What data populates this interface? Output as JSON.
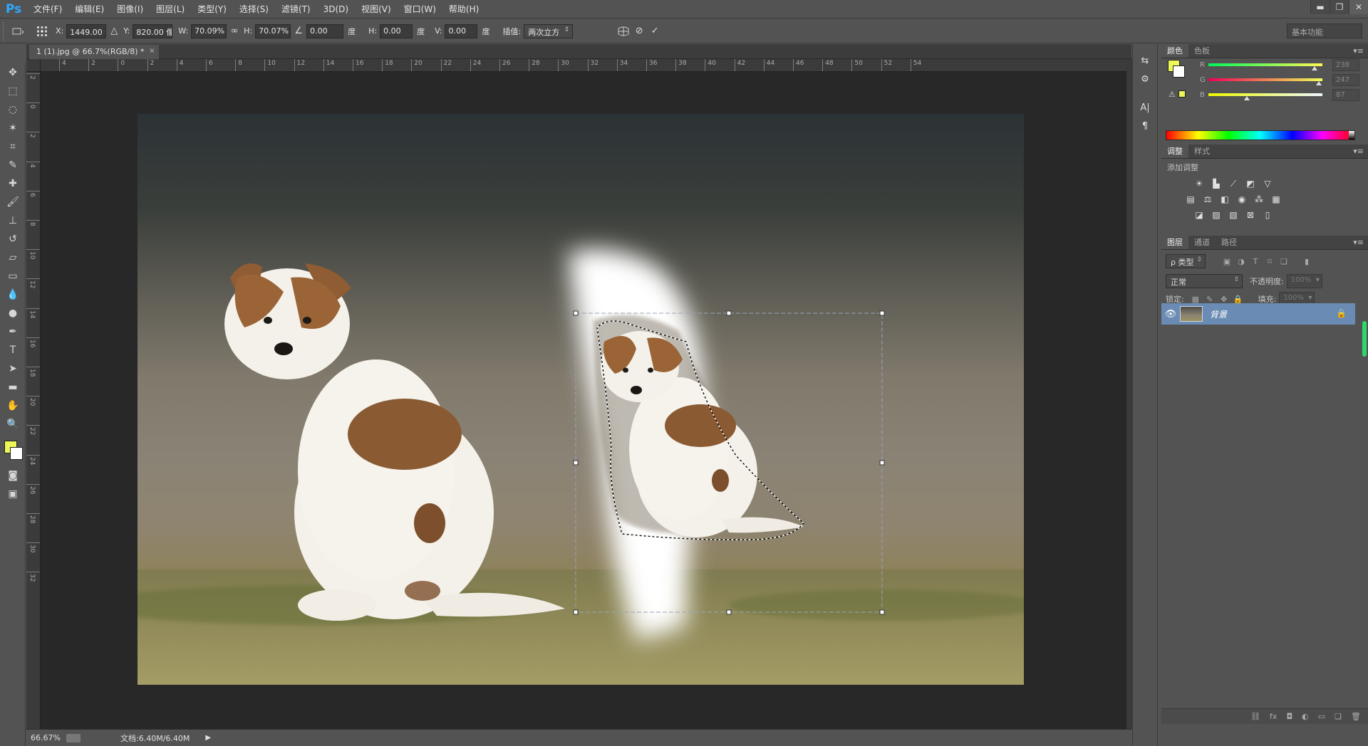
{
  "app": {
    "logo": "Ps",
    "menus": [
      "文件(F)",
      "编辑(E)",
      "图像(I)",
      "图层(L)",
      "类型(Y)",
      "选择(S)",
      "滤镜(T)",
      "3D(D)",
      "视图(V)",
      "窗口(W)",
      "帮助(H)"
    ],
    "window_controls": {
      "minimize": "▬",
      "restore": "❐",
      "close": "✕"
    }
  },
  "options_bar": {
    "x_label": "X:",
    "x_value": "1449.00 像",
    "y_label": "Y:",
    "y_value": "820.00 像",
    "w_label": "W:",
    "w_value": "70.09%",
    "h_label": "H:",
    "h_value": "70.07%",
    "angle_value": "0.00",
    "angle_unit": "度",
    "hskew_label": "H:",
    "hskew_value": "0.00",
    "hskew_unit": "度",
    "vskew_label": "V:",
    "vskew_value": "0.00",
    "vskew_unit": "度",
    "interp_label": "插值:",
    "interp_value": "两次立方",
    "workspace": "基本功能"
  },
  "document": {
    "tab_title": "1 (1).jpg @ 66.7%(RGB/8) *",
    "close": "×"
  },
  "rulers": {
    "h_labels": [
      "4",
      "2",
      "0",
      "2",
      "4",
      "6",
      "8",
      "10",
      "12",
      "14",
      "16",
      "18",
      "20",
      "22",
      "24",
      "26",
      "28",
      "30",
      "32",
      "34",
      "36",
      "38",
      "40",
      "42",
      "44",
      "46",
      "48",
      "50",
      "52",
      "54"
    ],
    "v_labels": [
      "2",
      "0",
      "2",
      "4",
      "6",
      "8",
      "10",
      "12",
      "14",
      "16",
      "18",
      "20",
      "22",
      "24",
      "26",
      "28",
      "30",
      "32"
    ]
  },
  "toolbox": {
    "fg_color": "#eef757",
    "bg_color": "#ffffff"
  },
  "status": {
    "zoom": "66.67%",
    "doc_info": "文档:6.40M/6.40M",
    "arrow": "▶"
  },
  "color_panel": {
    "tabs": [
      "颜色",
      "色板"
    ],
    "fg_color": "#eef757",
    "r_label": "R",
    "r_value": "238",
    "r_level": 0.93,
    "g_label": "G",
    "g_value": "247",
    "g_level": 0.97,
    "b_label": "B",
    "b_value": "87",
    "b_level": 0.34
  },
  "adjustments_panel": {
    "tabs": [
      "调整",
      "样式"
    ],
    "title": "添加调整"
  },
  "layers_panel": {
    "tabs": [
      "图层",
      "通道",
      "路径"
    ],
    "filter_kind": "ρ 类型",
    "blend_mode": "正常",
    "opacity_label": "不透明度:",
    "opacity_value": "100%",
    "lock_label": "锁定:",
    "fill_label": "填充:",
    "fill_value": "100%",
    "layer_name": "背景"
  }
}
